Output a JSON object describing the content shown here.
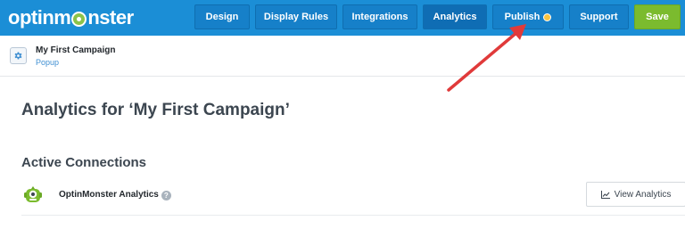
{
  "header": {
    "logo_text_before": "optinm",
    "logo_text_after": "nster",
    "nav": [
      {
        "label": "Design"
      },
      {
        "label": "Display Rules"
      },
      {
        "label": "Integrations"
      },
      {
        "label": "Analytics",
        "active": true
      },
      {
        "label": "Publish",
        "badge": "status-dot"
      },
      {
        "label": "Support"
      }
    ],
    "save_label": "Save"
  },
  "campaign": {
    "name": "My First Campaign",
    "type": "Popup"
  },
  "main": {
    "title": "Analytics for ‘My First Campaign’",
    "connections_heading": "Active Connections",
    "connections": [
      {
        "name": "OptinMonster Analytics",
        "help_icon": "?",
        "action_label": "View Analytics"
      }
    ]
  },
  "colors": {
    "brand_blue": "#1b8ed6",
    "save_green": "#7bbb2e",
    "arrow_red": "#e03a3a"
  },
  "icons": [
    "gear-icon",
    "help-icon",
    "chart-icon",
    "monster-icon",
    "status-dot"
  ]
}
